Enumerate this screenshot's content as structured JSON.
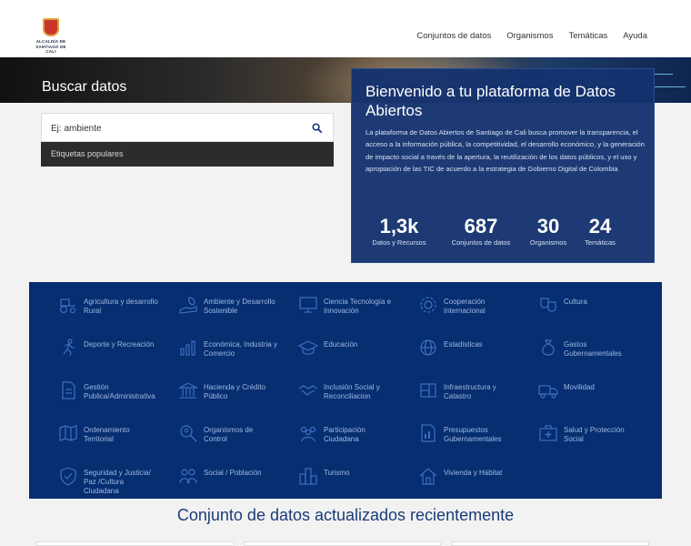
{
  "header": {
    "logo_line1": "ALCALDÍA DE",
    "logo_line2": "SANTIAGO DE CALI",
    "nav": [
      "Conjuntos de datos",
      "Organismos",
      "Temáticas",
      "Ayuda"
    ]
  },
  "hero": {
    "title": "Buscar datos"
  },
  "search": {
    "placeholder": "Ej: ambiente",
    "tags_label": "Etiquetas populares"
  },
  "welcome": {
    "title": "Bienvenido a tu plataforma de Datos Abiertos",
    "description": "La plataforma de Datos Abiertos de Santiago de Cali busca promover la transparencia, el acceso a la información pública, la competitividad, el desarrollo económico, y la generación de impacto social a través de la apertura, la reutilización de los datos públicos, y el uso y apropiación de las TIC de acuerdo a la estrategia de Gobierno Digital de Colombia",
    "stats": [
      {
        "value": "1,3k",
        "label": "Datos y Recursos"
      },
      {
        "value": "687",
        "label": "Conjuntos de datos"
      },
      {
        "value": "30",
        "label": "Organismos"
      },
      {
        "value": "24",
        "label": "Temáticas"
      }
    ]
  },
  "topics": [
    {
      "label": "Agricultura y desarrollo Rural",
      "icon": "tractor-icon"
    },
    {
      "label": "Ambiente y Desarrollo Sostenible",
      "icon": "hand-leaf-icon"
    },
    {
      "label": "Ciencia Tecnología e Innovación",
      "icon": "monitor-icon"
    },
    {
      "label": "Cooperación Internacional",
      "icon": "gear-icon"
    },
    {
      "label": "Cultura",
      "icon": "theater-masks-icon"
    },
    {
      "label": "Deporte y Recreación",
      "icon": "runner-icon"
    },
    {
      "label": "Económica, Industria y Comercio",
      "icon": "bar-chart-icon"
    },
    {
      "label": "Educación",
      "icon": "graduation-cap-icon"
    },
    {
      "label": "Estadisticas",
      "icon": "globe-network-icon"
    },
    {
      "label": "Gastos Gubernamentales",
      "icon": "money-bag-icon"
    },
    {
      "label": "Gestión Publica/Administrativa",
      "icon": "document-icon"
    },
    {
      "label": "Hacienda y Crédito Público",
      "icon": "bank-icon"
    },
    {
      "label": "Inclusión Social y Reconciliacion",
      "icon": "handshake-icon"
    },
    {
      "label": "Infraestructura y Catastro",
      "icon": "blueprint-icon"
    },
    {
      "label": "Movilidad",
      "icon": "truck-icon"
    },
    {
      "label": "Ordenamiento Territorial",
      "icon": "map-icon"
    },
    {
      "label": "Organismos de Control",
      "icon": "magnifier-people-icon"
    },
    {
      "label": "Participación Ciudadana",
      "icon": "people-group-icon"
    },
    {
      "label": "Presupuestos Gubernamentales",
      "icon": "report-icon"
    },
    {
      "label": "Salud y Protección Social",
      "icon": "medical-kit-icon"
    },
    {
      "label": "Seguridad y Justicia/ Paz /Cultura Ciudadana",
      "icon": "shield-icon"
    },
    {
      "label": "Social / Población",
      "icon": "people-icon"
    },
    {
      "label": "Turismo",
      "icon": "city-icon"
    },
    {
      "label": "Vivienda y Hábitat",
      "icon": "house-icon"
    }
  ],
  "recent": {
    "title": "Conjunto de datos actualizados recientemente"
  },
  "colors": {
    "navy": "#062e70",
    "accent": "#1c3c78",
    "topic_text": "#9fb8e3"
  }
}
